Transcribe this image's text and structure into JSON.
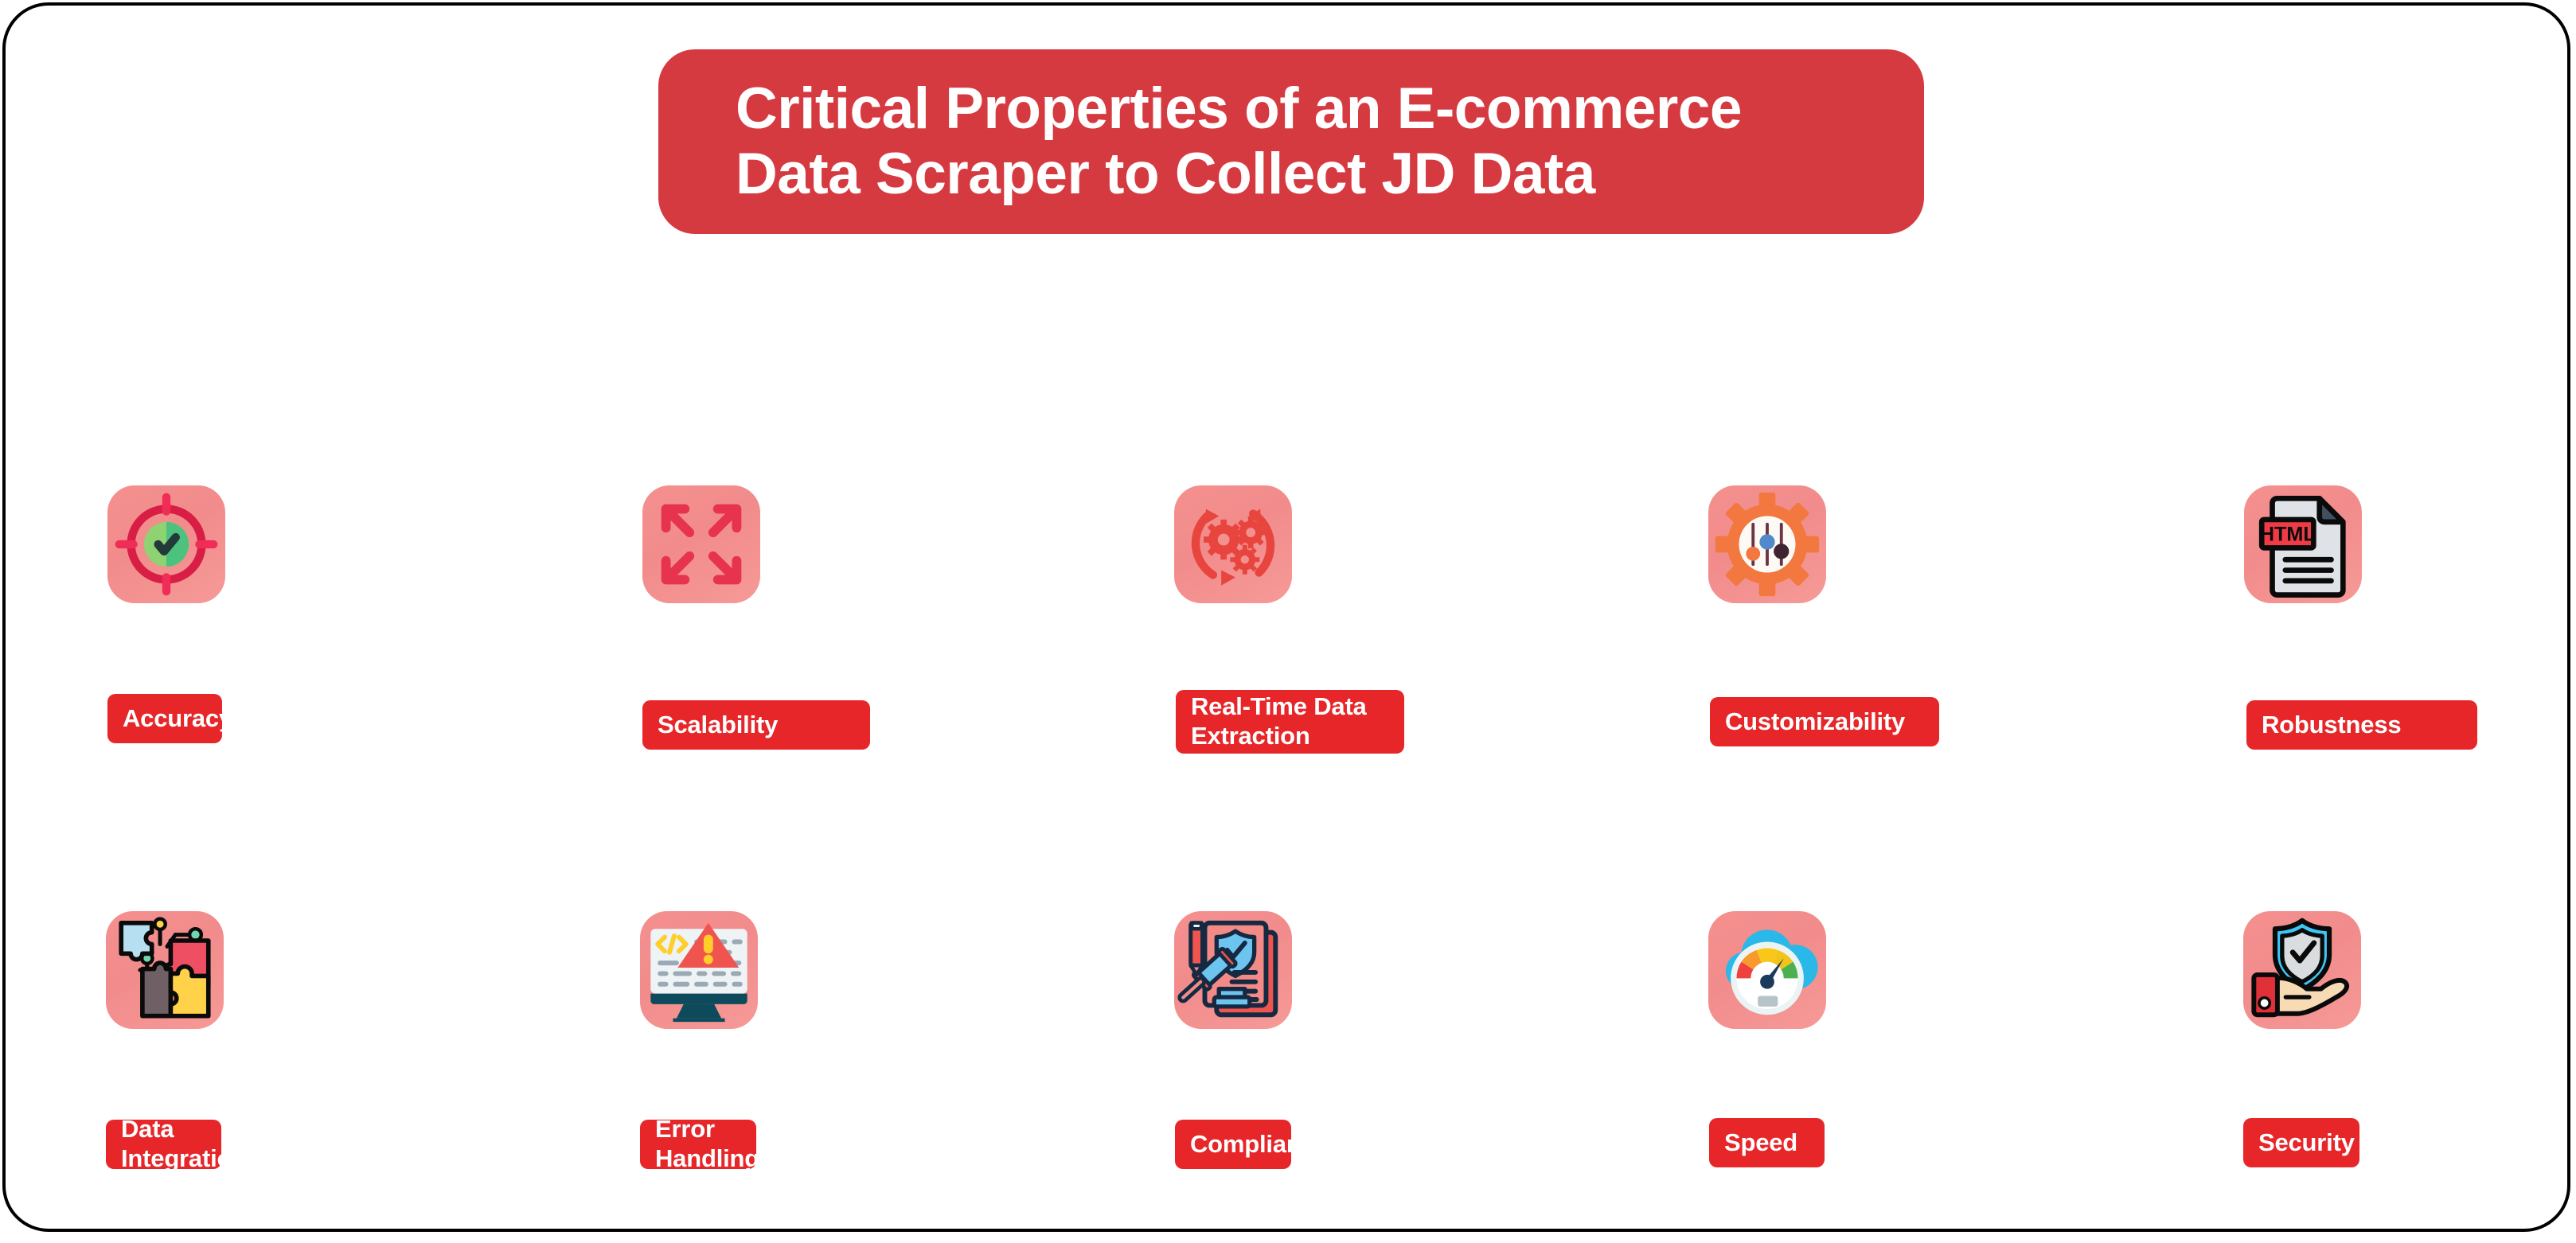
{
  "banner": {
    "title": "Critical Properties of an E-commerce\nData Scraper to Collect JD Data",
    "bg_color": "#d63a41",
    "text_color": "#ffffff"
  },
  "theme": {
    "frame_border_color": "#000000",
    "page_background": "#ffffff",
    "tile_background": "#f18c8c",
    "label_background": "#e62629",
    "label_text_color": "#ffffff"
  },
  "properties": [
    {
      "label": "Accuracy",
      "icon": "target-check-icon",
      "row": 1,
      "column": 1
    },
    {
      "label": "Scalability",
      "icon": "expand-arrows-icon",
      "row": 1,
      "column": 2
    },
    {
      "label": "Real-Time Data\nExtraction",
      "icon": "refresh-gears-icon",
      "row": 1,
      "column": 3
    },
    {
      "label": "Customizability",
      "icon": "gear-sliders-icon",
      "row": 1,
      "column": 4
    },
    {
      "label": "Robustness",
      "icon": "html-document-icon",
      "row": 1,
      "column": 5
    },
    {
      "label": "Data Integration",
      "icon": "puzzle-circuit-icon",
      "row": 2,
      "column": 1
    },
    {
      "label": "Error Handling",
      "icon": "monitor-warning-icon",
      "row": 2,
      "column": 2
    },
    {
      "label": "Compliance",
      "icon": "document-gavel-shield-icon",
      "row": 2,
      "column": 3
    },
    {
      "label": "Speed",
      "icon": "cloud-speedometer-icon",
      "row": 2,
      "column": 4
    },
    {
      "label": "Security",
      "icon": "hand-shield-icon",
      "row": 2,
      "column": 5
    }
  ]
}
